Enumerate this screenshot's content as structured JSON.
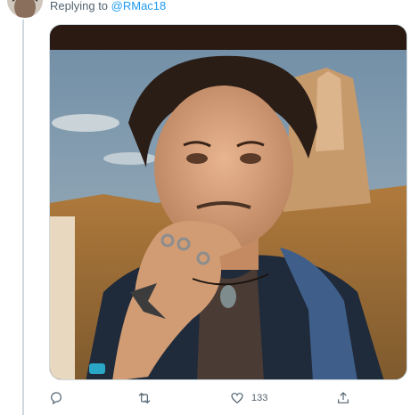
{
  "reply_context": {
    "prefix": "Replying to ",
    "handle": "@RMac18"
  },
  "avatar": {
    "icon": "user-avatar-icon"
  },
  "media": {
    "type": "photo"
  },
  "actions": {
    "reply": {
      "icon": "reply-icon",
      "count": ""
    },
    "retweet": {
      "icon": "retweet-icon",
      "count": ""
    },
    "like": {
      "icon": "heart-icon",
      "count": "133"
    },
    "share": {
      "icon": "share-icon",
      "count": ""
    }
  },
  "colors": {
    "accent": "#1d9bf0",
    "muted": "#536471",
    "border": "#cfd9de"
  }
}
